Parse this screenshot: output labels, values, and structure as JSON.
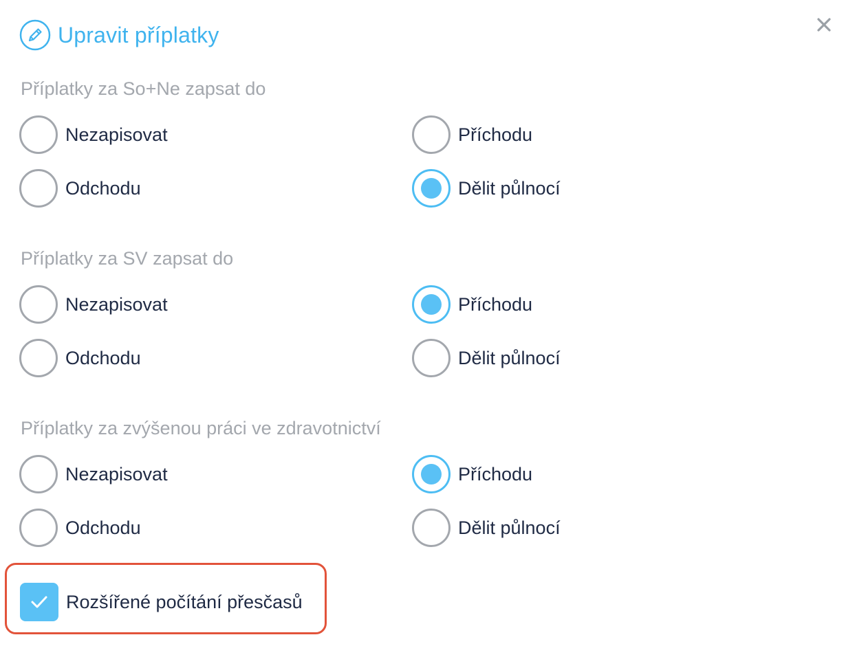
{
  "dialog": {
    "title": "Upravit příplatky",
    "title_icon": "pencil-circle-icon",
    "close_icon": "close-icon"
  },
  "groups": [
    {
      "label": "Příplatky za So+Ne zapsat do",
      "options": {
        "nezapisovat": "Nezapisovat",
        "prichodu": "Příchodu",
        "odchodu": "Odchodu",
        "delit": "Dělit půlnocí"
      },
      "selected": "Dělit půlnocí"
    },
    {
      "label": "Příplatky za SV zapsat do",
      "options": {
        "nezapisovat": "Nezapisovat",
        "prichodu": "Příchodu",
        "odchodu": "Odchodu",
        "delit": "Dělit půlnocí"
      },
      "selected": "Příchodu"
    },
    {
      "label": "Příplatky za zvýšenou práci ve zdravotnictví",
      "options": {
        "nezapisovat": "Nezapisovat",
        "prichodu": "Příchodu",
        "odchodu": "Odchodu",
        "delit": "Dělit půlnocí"
      },
      "selected": "Příchodu"
    }
  ],
  "extended_overtime": {
    "label": "Rozšířené počítání přesčasů",
    "checked": true
  },
  "colors": {
    "accent": "#3fb3ee",
    "radio_fill": "#5ac1f5",
    "muted": "#a3a7ad",
    "highlight": "#e2533a",
    "text": "#1f2a44"
  }
}
